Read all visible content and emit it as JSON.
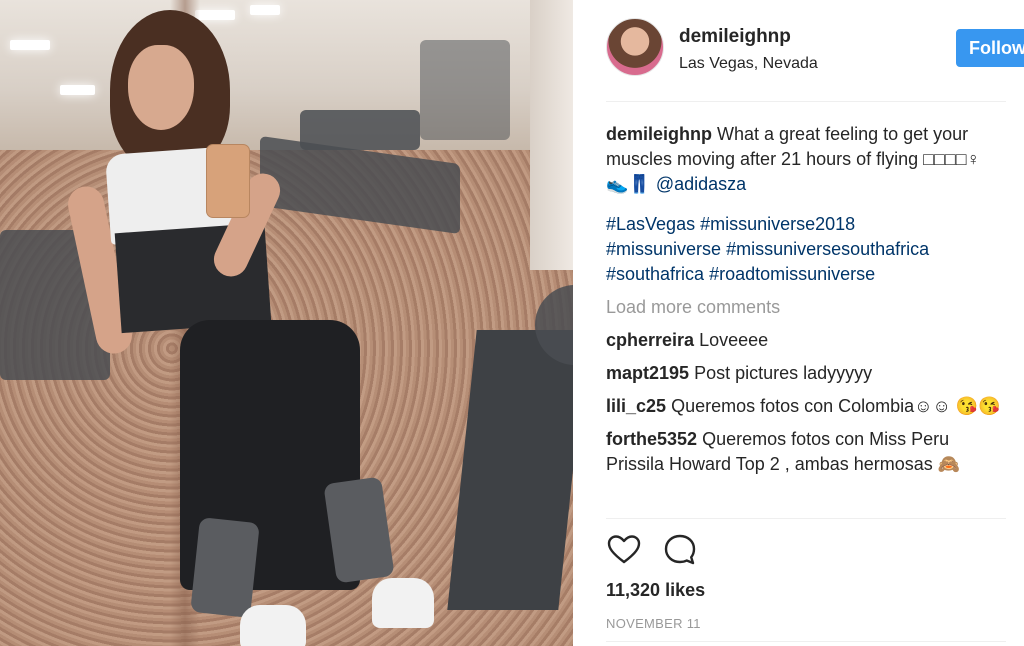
{
  "post": {
    "username": "demileighnp",
    "location": "Las Vegas, Nevada",
    "follow_label": "Follow",
    "caption": {
      "username": "demileighnp",
      "text": "What a great feeling to get your muscles moving after 21 hours of flying",
      "emoji_line": "□□□□♀ 👟👖",
      "mention": "@adidasza"
    },
    "hashtags": [
      "#LasVegas",
      "#missuniverse2018",
      "#missuniverse",
      "#missuniversesouthafrica",
      "#southafrica",
      "#roadtomissuniverse"
    ],
    "load_more": "Load more comments",
    "comments": [
      {
        "username": "cpherreira",
        "text": "Loveeee"
      },
      {
        "username": "mapt2195",
        "text": "Post pictures ladyyyyy"
      },
      {
        "username": "lili_c25",
        "text": "Queremos fotos con Colombia☺☺ 😘😘"
      },
      {
        "username": "forthe5352",
        "text": "Queremos fotos con Miss Peru Prissila Howard Top 2 , ambas hermosas 🙈"
      }
    ],
    "likes": "11,320 likes",
    "date": "NOVEMBER 11"
  },
  "icons": {
    "like": "heart-icon",
    "comment": "comment-bubble-icon"
  },
  "colors": {
    "follow_button": "#3897f0",
    "link": "#003569",
    "muted": "#999999",
    "text": "#262626"
  }
}
